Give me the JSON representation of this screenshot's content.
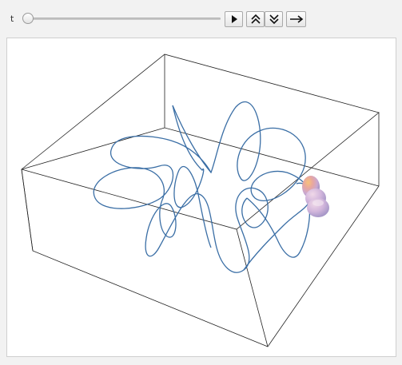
{
  "controls": {
    "t_label": "t",
    "slider_value": 0,
    "buttons": [
      {
        "name": "play-button",
        "icon": "play-icon"
      },
      {
        "name": "faster-button",
        "icon": "double-chevron-up-icon"
      },
      {
        "name": "slower-button",
        "icon": "double-chevron-down-icon"
      },
      {
        "name": "direction-button",
        "icon": "right-arrow-icon"
      }
    ]
  },
  "plot": {
    "curve_color": "#3a6ea5",
    "box_color": "#222222",
    "tube_color": "#c9a8c8"
  }
}
